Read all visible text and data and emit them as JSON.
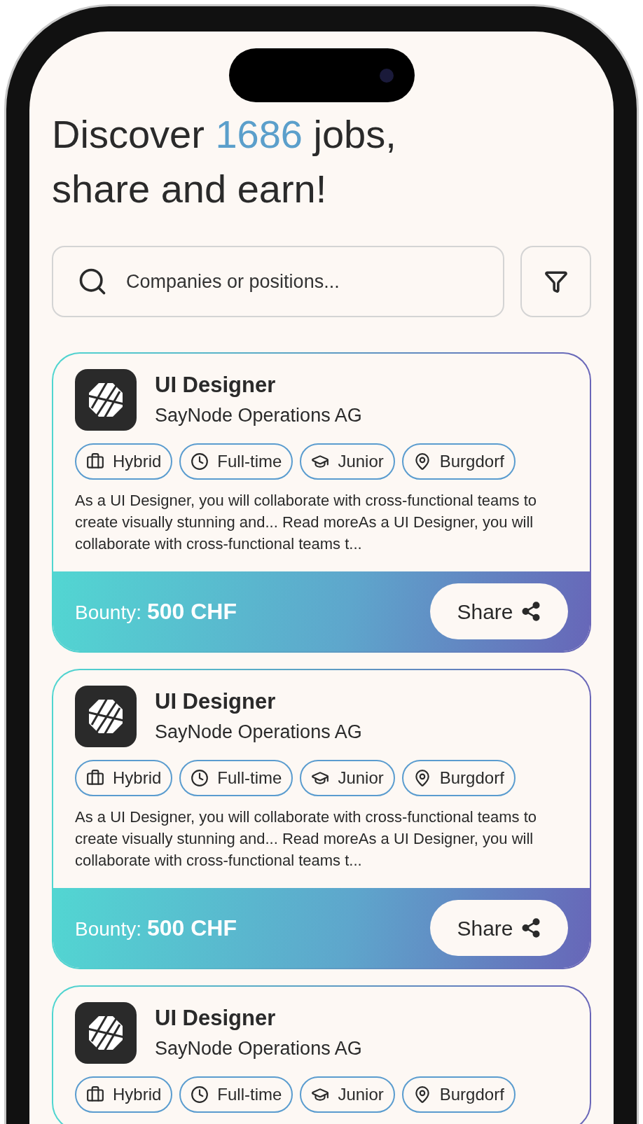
{
  "heading": {
    "prefix": "Discover",
    "count": "1686",
    "suffix": "jobs, share and earn!"
  },
  "search": {
    "placeholder": "Companies or positions..."
  },
  "jobs": [
    {
      "title": "UI Designer",
      "company": "SayNode Operations AG",
      "tags": [
        {
          "kind": "work_mode",
          "label": "Hybrid"
        },
        {
          "kind": "schedule",
          "label": "Full-time"
        },
        {
          "kind": "level",
          "label": "Junior"
        },
        {
          "kind": "location",
          "label": "Burgdorf"
        }
      ],
      "description": "As a UI Designer, you will collaborate with cross-functional teams to create visually stunning and... Read moreAs a UI Designer, you will collaborate with cross-functional teams t...",
      "bounty_label": "Bounty:",
      "bounty_value": "500 CHF",
      "share": "Share"
    },
    {
      "title": "UI Designer",
      "company": "SayNode Operations AG",
      "tags": [
        {
          "kind": "work_mode",
          "label": "Hybrid"
        },
        {
          "kind": "schedule",
          "label": "Full-time"
        },
        {
          "kind": "level",
          "label": "Junior"
        },
        {
          "kind": "location",
          "label": "Burgdorf"
        }
      ],
      "description": "As a UI Designer, you will collaborate with cross-functional teams to create visually stunning and... Read moreAs a UI Designer, you will collaborate with cross-functional teams t...",
      "bounty_label": "Bounty:",
      "bounty_value": "500 CHF",
      "share": "Share"
    },
    {
      "title": "UI Designer",
      "company": "SayNode Operations AG",
      "tags": [
        {
          "kind": "work_mode",
          "label": "Hybrid"
        },
        {
          "kind": "schedule",
          "label": "Full-time"
        },
        {
          "kind": "level",
          "label": "Junior"
        },
        {
          "kind": "location",
          "label": "Burgdorf"
        }
      ]
    }
  ]
}
